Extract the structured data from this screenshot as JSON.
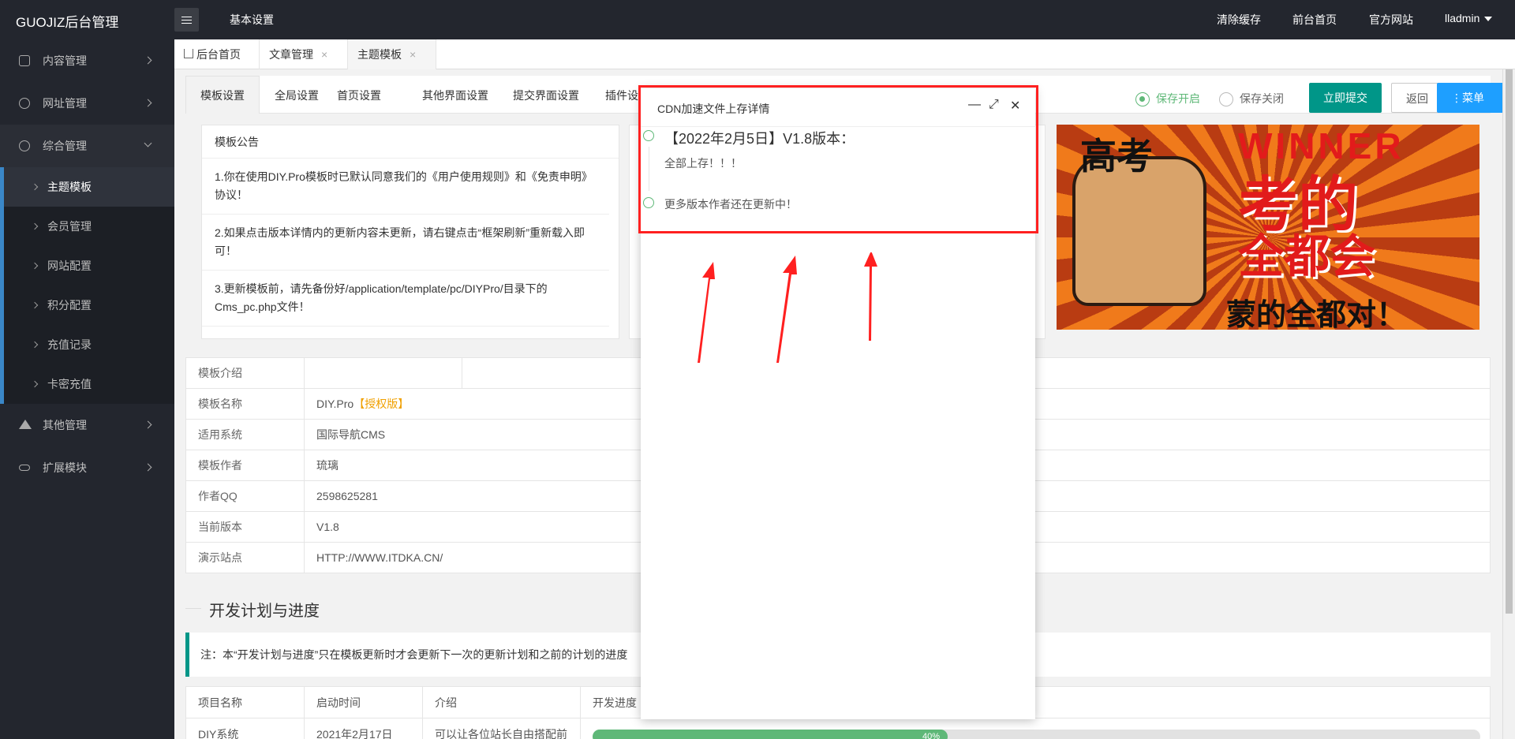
{
  "topbar": {
    "logo": "GUOJIZ后台管理",
    "basic_settings": "基本设置",
    "links": [
      "清除缓存",
      "前台首页",
      "官方网站"
    ],
    "user": "lladmin"
  },
  "sidebar": {
    "items": [
      {
        "label": "内容管理",
        "icon": "doc-icon"
      },
      {
        "label": "网址管理",
        "icon": "globe-icon"
      },
      {
        "label": "综合管理",
        "icon": "gear-icon"
      }
    ],
    "sub_items": [
      "主题模板",
      "会员管理",
      "网站配置",
      "积分配置",
      "充值记录",
      "卡密充值"
    ],
    "bottom_items": [
      {
        "label": "其他管理",
        "icon": "send-icon"
      },
      {
        "label": "扩展模块",
        "icon": "link-icon"
      }
    ]
  },
  "tabs": [
    {
      "label": "后台首页",
      "icon": "home-icon"
    },
    {
      "label": "文章管理",
      "close": "×"
    },
    {
      "label": "主题模板",
      "close": "×"
    }
  ],
  "subtabs": [
    "模板设置",
    "全局设置",
    "首页设置",
    "其他界面设置",
    "提交界面设置",
    "插件设"
  ],
  "controls": {
    "save_on": "保存开启",
    "save_off": "保存关闭",
    "submit": "立即提交",
    "back": "返回",
    "menu": "⋮菜单"
  },
  "notice": {
    "title": "模板公告",
    "items": [
      "1.你在使用DIY.Pro模板时已默认同意我们的《用户使用规则》和《免责申明》协议！",
      "2.如果点击版本详情内的更新内容未更新，请右键点击“框架刷新”重新载入即可！",
      "3.更新模板前，请先备份好/application/template/pc/DIYPro/目录下的Cms_pc.php文件！"
    ]
  },
  "banner": {
    "t_top_left": "高考",
    "t_top_right": "WINNER",
    "t1": "考的",
    "t2": "全都会",
    "t3": "蒙的全都对！"
  },
  "info": {
    "header": "模板介绍",
    "rows": [
      {
        "k": "模板名称",
        "v": "DIY.Pro",
        "auth": "【授权版】"
      },
      {
        "k": "适用系统",
        "v": "国际导航CMS"
      },
      {
        "k": "模板作者",
        "v": "琉璃"
      },
      {
        "k": "作者QQ",
        "v": "2598625281"
      },
      {
        "k": "当前版本",
        "v": "V1.8"
      },
      {
        "k": "演示站点",
        "v": "HTTP://WWW.ITDKA.CN/"
      }
    ]
  },
  "plan": {
    "title": "开发计划与进度",
    "note": "注：本“开发计划与进度”只在模板更新时才会更新下一次的更新计划和之前的计划的进度",
    "headers": [
      "项目名称",
      "启动时间",
      "介绍",
      "开发进度"
    ],
    "row": {
      "name": "DIY系统",
      "date": "2021年2月17日",
      "desc": "可以让各位站长自由搭配前",
      "progress_label": "40%",
      "progress_fraction": 0.4
    }
  },
  "dialog": {
    "title": "CDN加速文件上存详情",
    "minimize": "—",
    "maximize": "⤢",
    "close": "✕",
    "entry_title": "【2022年2月5日】V1.8版本：",
    "entry_text": "全部上存！！！",
    "more": "更多版本作者还在更新中！"
  },
  "colors": {
    "accent_green": "#009688",
    "accent_blue": "#1e9fff",
    "highlight_red": "#ff2020",
    "dark_bg": "#23262e"
  }
}
